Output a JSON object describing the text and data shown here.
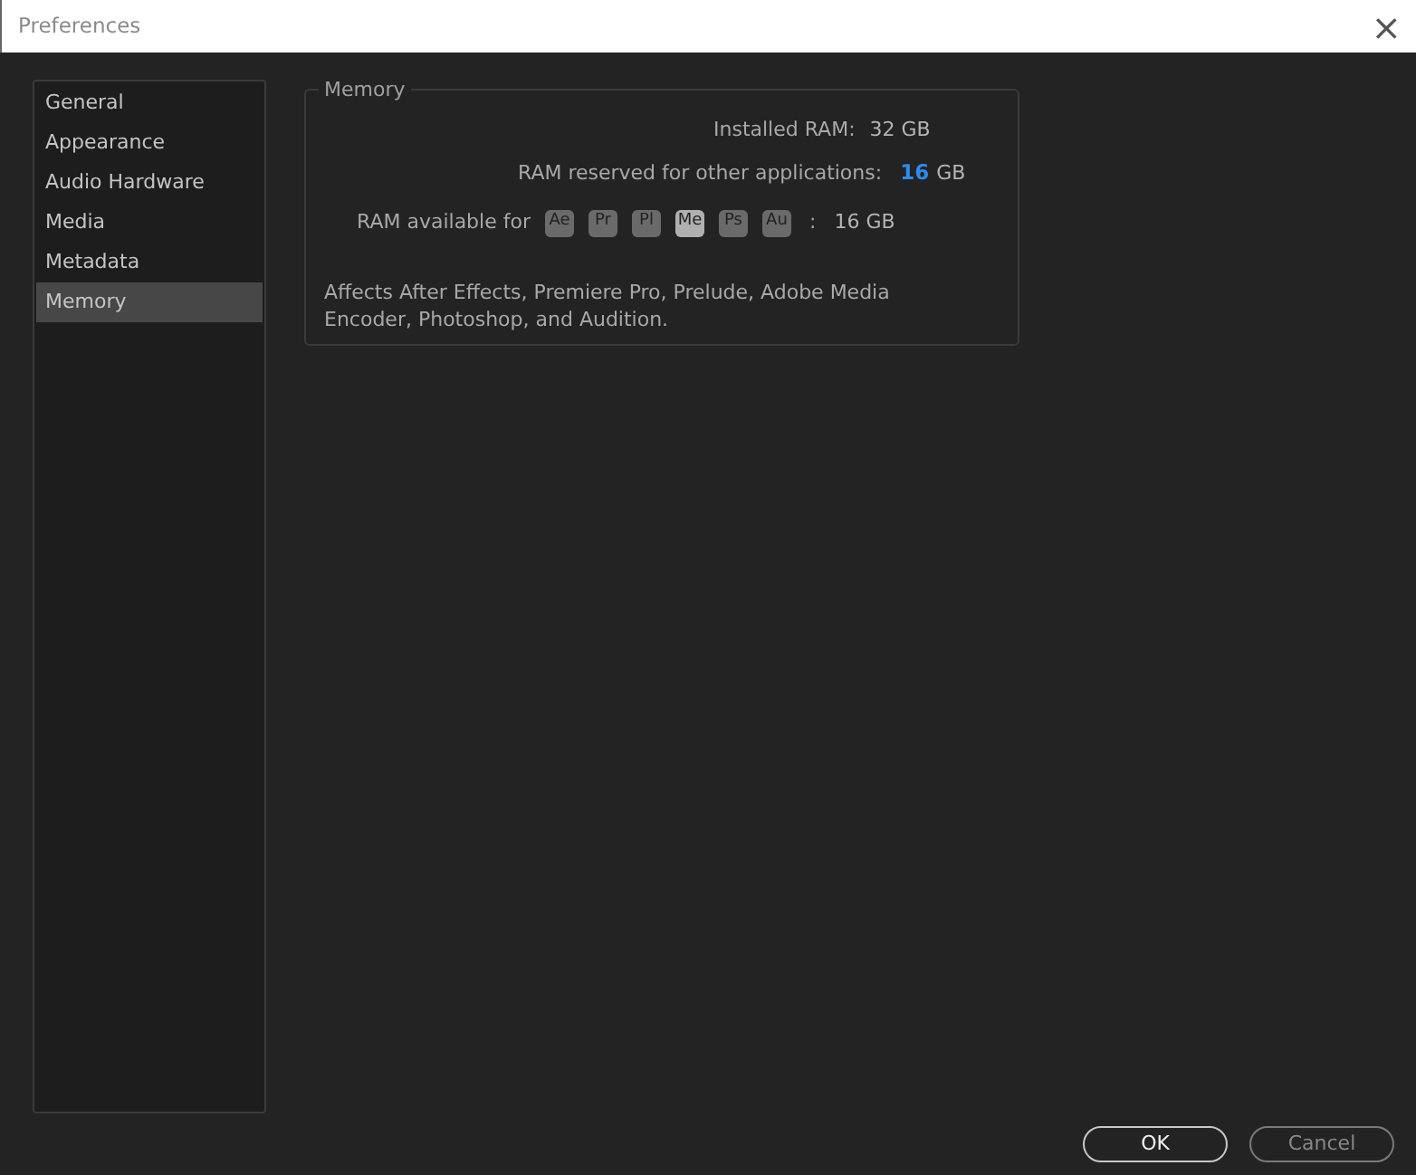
{
  "window": {
    "title": "Preferences",
    "close": "×"
  },
  "sidebar": {
    "items": [
      {
        "label": "General",
        "selected": false
      },
      {
        "label": "Appearance",
        "selected": false
      },
      {
        "label": "Audio Hardware",
        "selected": false
      },
      {
        "label": "Media",
        "selected": false
      },
      {
        "label": "Metadata",
        "selected": false
      },
      {
        "label": "Memory",
        "selected": true
      }
    ]
  },
  "memory": {
    "title": "Memory",
    "installed_label": "Installed RAM:",
    "installed_value": "32 GB",
    "reserved_label": "RAM reserved for other applications:",
    "reserved_value": "16",
    "reserved_unit": "GB",
    "available_label": "RAM available for",
    "apps": [
      {
        "label": "Ae",
        "selected": false
      },
      {
        "label": "Pr",
        "selected": false
      },
      {
        "label": "Pl",
        "selected": false
      },
      {
        "label": "Me",
        "selected": true
      },
      {
        "label": "Ps",
        "selected": false
      },
      {
        "label": "Au",
        "selected": false
      }
    ],
    "available_sep": ":",
    "available_value": "16 GB",
    "note": "Affects After Effects, Premiere Pro, Prelude, Adobe Media Encoder, Photoshop, and Audition."
  },
  "buttons": [
    {
      "label": "OK",
      "default": true
    },
    {
      "label": "Cancel",
      "default": false
    }
  ]
}
